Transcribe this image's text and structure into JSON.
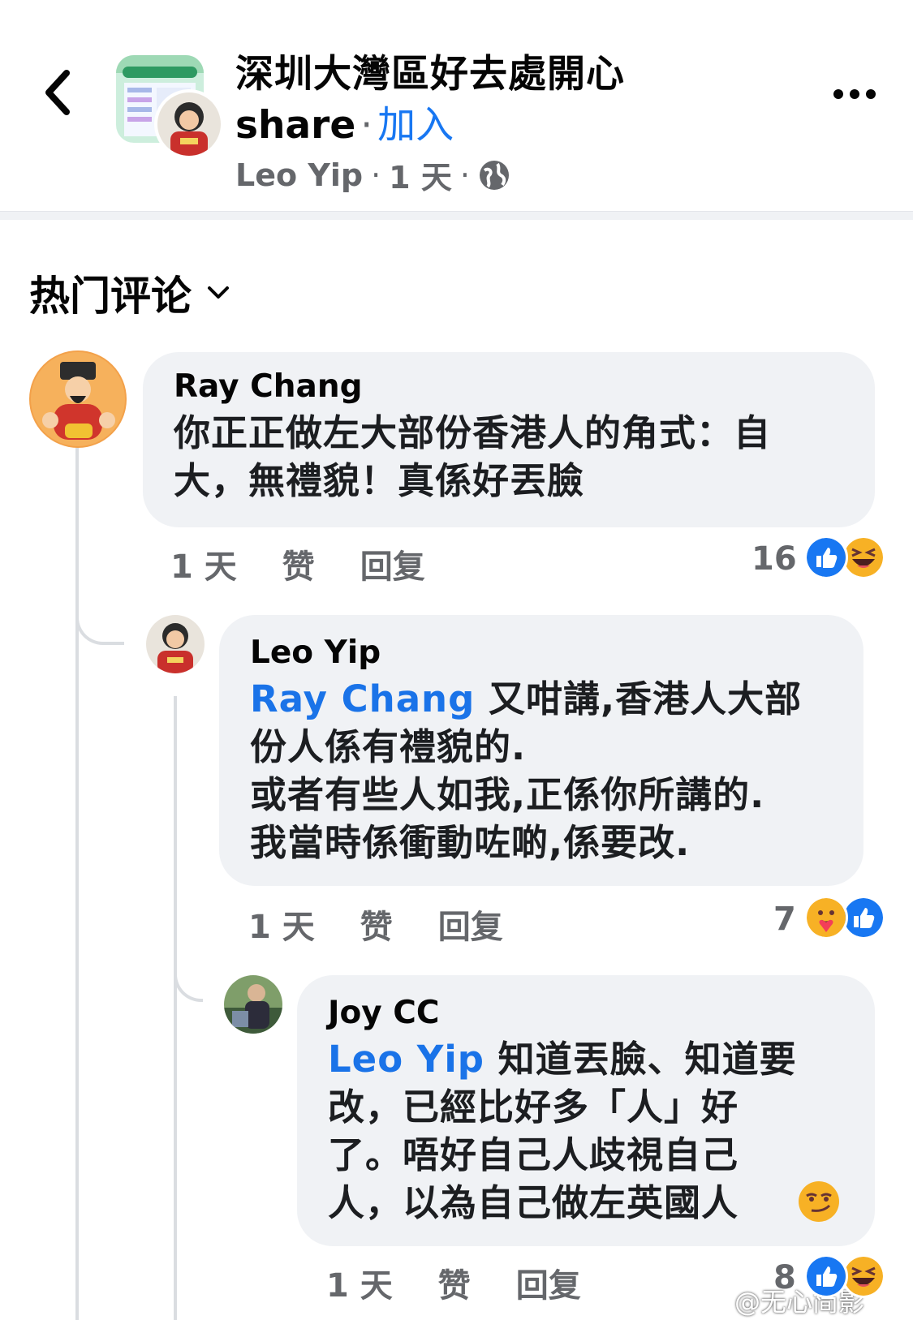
{
  "header": {
    "group_title_line1": "深圳大灣區好去處開心",
    "group_title_line2": "share",
    "separator": "·",
    "join_label": "加入",
    "post_author": "Leo Yip",
    "post_time": "1 天",
    "icons": {
      "back": "back-chevron-icon",
      "more": "more-options-icon",
      "privacy": "globe-icon"
    }
  },
  "sort": {
    "label": "热门评论"
  },
  "comments": [
    {
      "name": "Ray Chang",
      "mention": "",
      "text": "你正正做左大部份香港人的角式：自\n大，無禮貌！真係好丟臉",
      "time": "1 天",
      "like_label": "赞",
      "reply_label": "回复",
      "reaction_count": "16",
      "reactions": [
        "like",
        "haha"
      ]
    },
    {
      "name": "Leo Yip",
      "mention": "Ray Chang",
      "text": " 又咁講,香港人大部\n份人係有禮貌的.\n或者有些人如我,正係你所講的.\n我當時係衝動咗啲,係要改.",
      "time": "1 天",
      "like_label": "赞",
      "reply_label": "回复",
      "reaction_count": "7",
      "reactions": [
        "care",
        "like"
      ]
    },
    {
      "name": "Joy CC",
      "mention": "Leo Yip",
      "text": " 知道丟臉、知道要\n改，已經比好多「人」好\n了。唔好自己人歧視自己\n人，以為自己做左英國人",
      "emoji": "smirk-emoji",
      "time": "1 天",
      "like_label": "赞",
      "reply_label": "回复",
      "reaction_count": "8",
      "reactions": [
        "like",
        "haha"
      ]
    }
  ],
  "watermark": "@无心简影",
  "colors": {
    "link": "#1877f2",
    "bubble": "#f0f2f5",
    "secondary": "#65676b"
  }
}
